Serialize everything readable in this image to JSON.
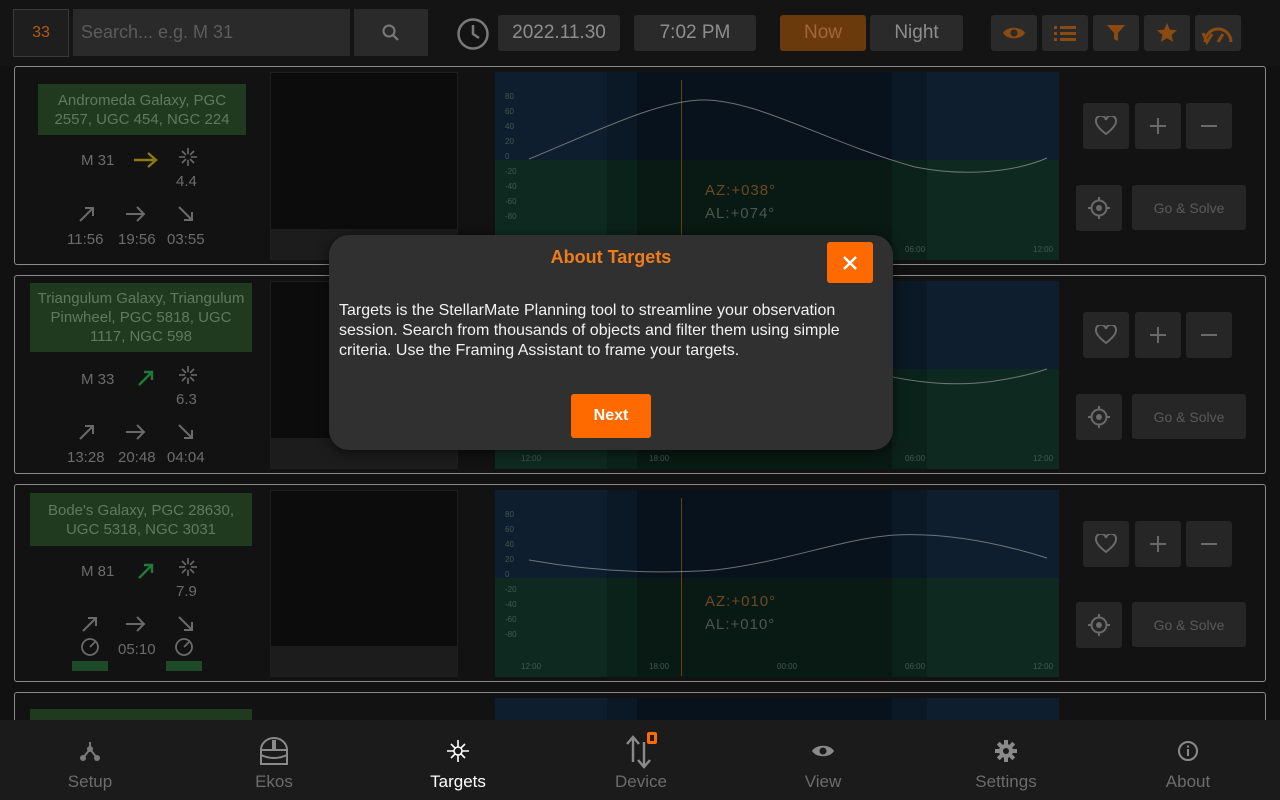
{
  "header": {
    "count": "33",
    "search_placeholder": "Search... e.g. M 31",
    "date": "2022.11.30",
    "time": "7:02 PM",
    "now_label": "Now",
    "night_label": "Night"
  },
  "targets": [
    {
      "name": "Andromeda Galaxy, PGC 2557, UGC 454, NGC 224",
      "catalog": "M 31",
      "magnitude": "4.4",
      "rise": "11:56",
      "transit": "19:56",
      "set": "03:55",
      "az": "AZ:+038°",
      "al": "AL:+074°",
      "go_solve": "Go & Solve"
    },
    {
      "name": "Triangulum Galaxy, Triangulum Pinwheel, PGC 5818, UGC 1117, NGC 598",
      "catalog": "M 33",
      "magnitude": "6.3",
      "rise": "13:28",
      "transit": "20:48",
      "set": "04:04",
      "go_solve": "Go & Solve"
    },
    {
      "name": "Bode's Galaxy, PGC 28630, UGC 5318, NGC 3031",
      "catalog": "M 81",
      "magnitude": "7.9",
      "transit": "05:10",
      "az": "AZ:+010°",
      "al": "AL:+010°",
      "go_solve": "Go & Solve"
    }
  ],
  "chart_axis": {
    "y_ticks": [
      "80",
      "60",
      "40",
      "20",
      "0",
      "-20",
      "-40",
      "-60",
      "-80"
    ],
    "x_ticks": [
      "12:00",
      "18:00",
      "00:00",
      "06:00",
      "12:00"
    ]
  },
  "nav": {
    "setup": "Setup",
    "ekos": "Ekos",
    "targets": "Targets",
    "device": "Device",
    "view": "View",
    "settings": "Settings",
    "about": "About"
  },
  "modal": {
    "title": "About Targets",
    "body": "Targets is the StellarMate Planning tool to streamline your observation session. Search from thousands of objects and filter them using simple criteria. Use the Framing Assistant to frame your targets.",
    "next_label": "Next"
  },
  "colors": {
    "accent": "#ff6a00",
    "modal_bg": "#303030",
    "title_orange": "#f07d1a"
  }
}
